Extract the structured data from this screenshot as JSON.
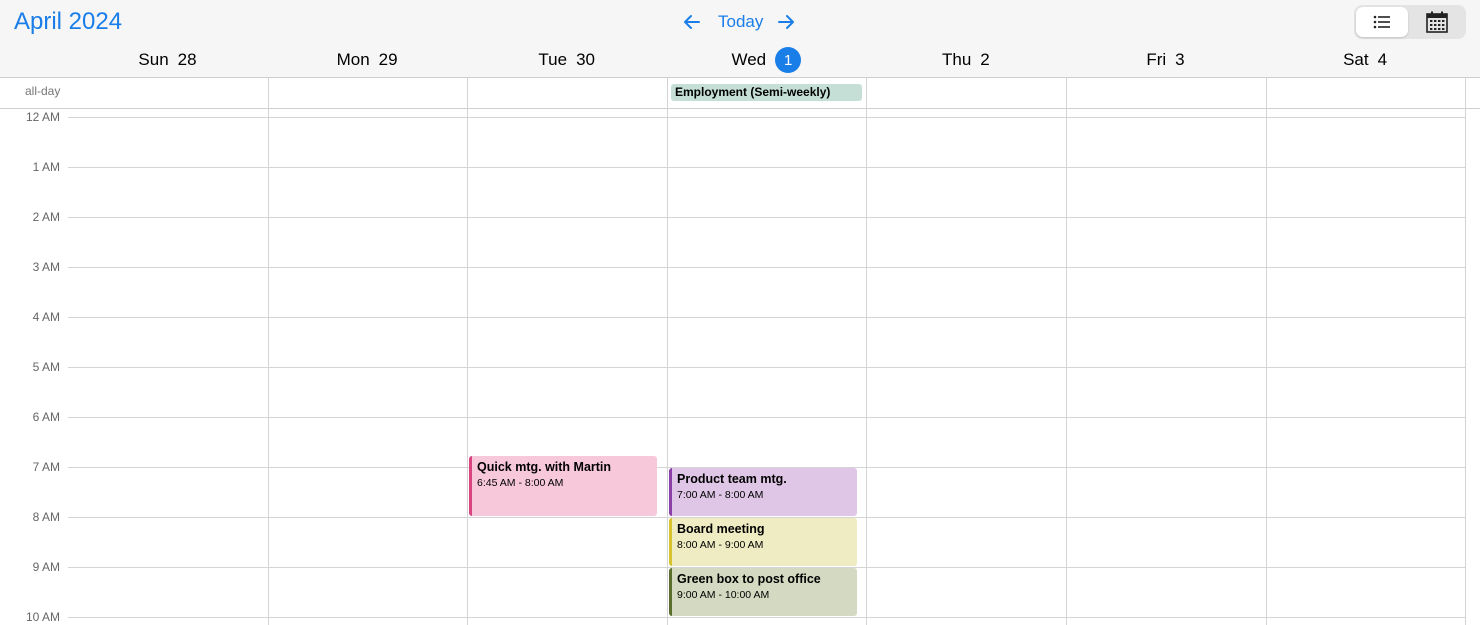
{
  "header": {
    "month_title": "April 2024",
    "today_label": "Today",
    "prev_icon": "arrow-left-icon",
    "next_icon": "arrow-right-icon",
    "accent_color": "#1a7ee8",
    "views": [
      {
        "name": "list-view",
        "icon": "list-icon",
        "active": true
      },
      {
        "name": "calendar-view",
        "icon": "calendar-grid-icon",
        "active": false
      }
    ]
  },
  "days": [
    {
      "name": "Sun",
      "num": "28",
      "today": false
    },
    {
      "name": "Mon",
      "num": "29",
      "today": false
    },
    {
      "name": "Tue",
      "num": "30",
      "today": false
    },
    {
      "name": "Wed",
      "num": "1",
      "today": true
    },
    {
      "name": "Thu",
      "num": "2",
      "today": false
    },
    {
      "name": "Fri",
      "num": "3",
      "today": false
    },
    {
      "name": "Sat",
      "num": "4",
      "today": false
    }
  ],
  "allday": {
    "label": "all-day",
    "events": [
      {
        "title": "Employment (Semi-weekly)",
        "day": 3,
        "color": "#c5dfd6"
      }
    ]
  },
  "time_labels": [
    "12 AM",
    "1 AM",
    "2 AM",
    "3 AM",
    "4 AM",
    "5 AM",
    "6 AM",
    "7 AM",
    "8 AM",
    "9 AM",
    "10 AM"
  ],
  "events": [
    {
      "title": "Quick mtg. with Martin",
      "time": "6:45 AM - 8:00 AM",
      "day": 2,
      "start": 6.75,
      "end": 8.0,
      "bg": "#f7c8da",
      "accent": "#d8457e"
    },
    {
      "title": "Product team mtg.",
      "time": "7:00 AM - 8:00 AM",
      "day": 3,
      "start": 7.0,
      "end": 8.0,
      "bg": "#dfc6e6",
      "accent": "#8b3fa8"
    },
    {
      "title": "Board meeting",
      "time": "8:00 AM - 9:00 AM",
      "day": 3,
      "start": 8.0,
      "end": 9.0,
      "bg": "#efebc2",
      "accent": "#d7c22f"
    },
    {
      "title": "Green box to post office",
      "time": "9:00 AM - 10:00 AM",
      "day": 3,
      "start": 9.0,
      "end": 10.0,
      "bg": "#d4dac2",
      "accent": "#5b6e2d"
    }
  ]
}
